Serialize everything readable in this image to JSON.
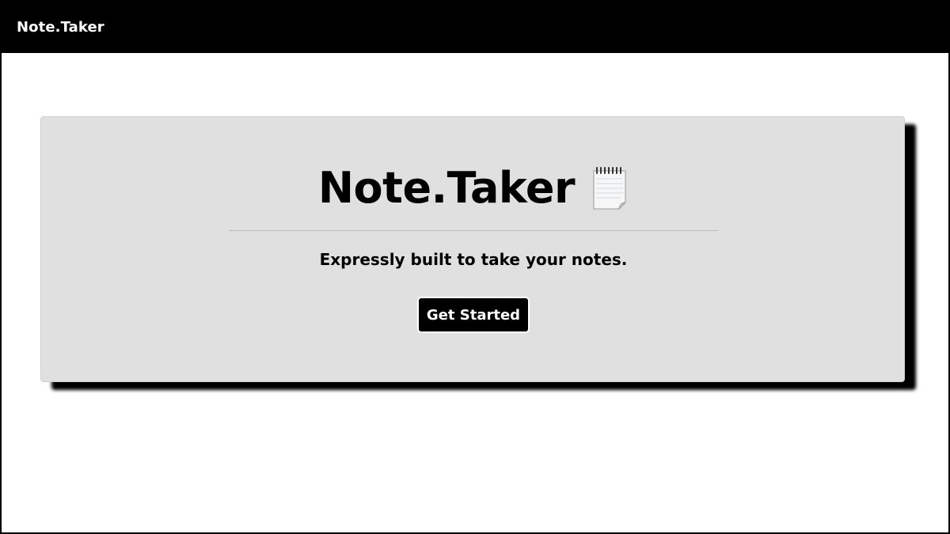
{
  "navbar": {
    "brand": "Note.Taker"
  },
  "hero": {
    "title": "Note.Taker",
    "title_icon": "notepad-icon",
    "subtitle": "Expressly built to take your notes.",
    "cta_label": "Get Started"
  },
  "colors": {
    "navbar_bg": "#000000",
    "hero_bg": "#e0e0e0",
    "button_bg": "#000000",
    "button_text": "#ffffff",
    "shadow": "#000000"
  }
}
